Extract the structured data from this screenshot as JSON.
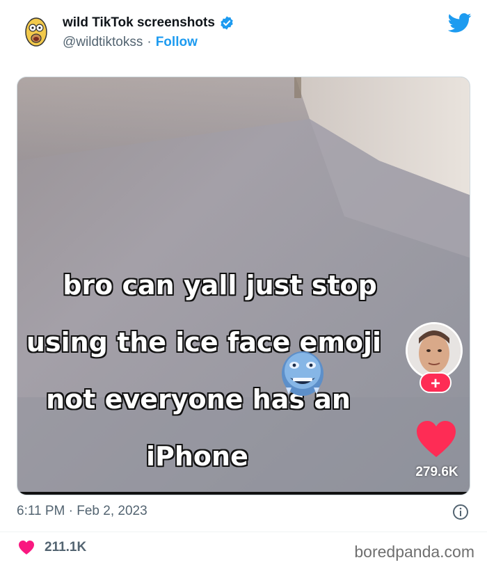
{
  "header": {
    "display_name": "wild TikTok screenshots",
    "handle": "@wildtiktokss",
    "separator": "·",
    "follow_label": "Follow",
    "avatar_icon": "cartoon-avatar-icon",
    "verified_icon": "verified-badge-icon",
    "platform_icon": "twitter-bird-icon"
  },
  "media": {
    "caption_lines": [
      "bro can yall just stop",
      "using the ice face emoji",
      "not everyone has an",
      "iPhone"
    ],
    "emoji_icon": "ice-face-emoji-icon",
    "creator_avatar_icon": "creator-avatar-icon",
    "follow_plus": "+",
    "like_icon": "heart-icon",
    "like_count": "279.6K"
  },
  "footer": {
    "time": "6:11 PM",
    "date": "Feb 2, 2023",
    "separator": "·",
    "info_icon": "info-icon",
    "likes_icon": "heart-icon",
    "likes_count": "211.1K",
    "watermark": "boredpanda.com"
  },
  "colors": {
    "accent": "#1d9bf0",
    "like": "#f91880",
    "tiktok_red": "#fe2c55",
    "muted_text": "#536471"
  }
}
